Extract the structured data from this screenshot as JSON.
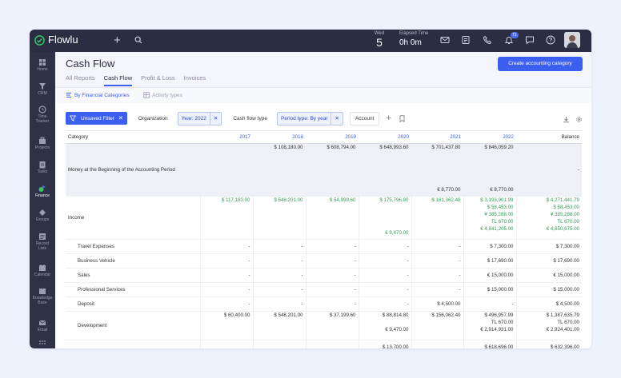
{
  "app": {
    "name": "Flowlu"
  },
  "topbar": {
    "date_weekday": "Wed",
    "date_day": "5",
    "elapsed_label": "Elapsed Time",
    "elapsed_value": "0h 0m",
    "notification_count": "71"
  },
  "sidebar": {
    "items": [
      {
        "label": "Home",
        "icon": "home-icon"
      },
      {
        "label": "CRM",
        "icon": "crm-icon"
      },
      {
        "label": "Time Tracker",
        "icon": "clock-icon"
      },
      {
        "label": "Projects",
        "icon": "projects-icon"
      },
      {
        "label": "Tasks",
        "icon": "tasks-icon"
      },
      {
        "label": "Finance",
        "icon": "finance-icon"
      },
      {
        "label": "Groups",
        "icon": "groups-icon"
      },
      {
        "label": "Record Lists",
        "icon": "record-lists-icon"
      },
      {
        "label": "Calendar",
        "icon": "calendar-icon"
      },
      {
        "label": "Knowledge Base",
        "icon": "knowledge-base-icon"
      },
      {
        "label": "Email",
        "icon": "email-icon"
      }
    ]
  },
  "header": {
    "title": "Cash Flow",
    "tabs": [
      "All Reports",
      "Cash Flow",
      "Profit & Loss",
      "Invoices"
    ],
    "create_button": "Create accounting category"
  },
  "subtabs": [
    "By Financial Categories",
    "Activity types"
  ],
  "filters": {
    "unsaved": "Unsaved Filter",
    "organization": "Organization",
    "year": "Year: 2022",
    "flow_type": "Cash flow type",
    "period": "Period type: By year",
    "account": "Account"
  },
  "table": {
    "headers": [
      "Category",
      "2017",
      "2018",
      "2019",
      "2020",
      "2021",
      "2022",
      "Balance"
    ],
    "money": {
      "label": "Money at the Beginning of the Accounting Period",
      "top": [
        "",
        "$ 108,180.00",
        "$ 608,794.00",
        "$ 648,993.60",
        "$ 701,437.80",
        "$ 846,059.20",
        ""
      ],
      "bottom": [
        "",
        "",
        "",
        "",
        "€ 8,770.00",
        "€ 8,770.00",
        ""
      ],
      "balance": "-"
    },
    "income": {
      "label": "Income",
      "top": [
        "$ 117,180.00",
        "$ 548,201.00",
        "$ 54,999.60",
        "$ 175,796.80",
        "$ 181,362.40",
        ""
      ],
      "col_2022": [
        "$ 3,193,901.99",
        "$ 58,453.00",
        "¥ 385,288.00",
        "TL 670.00",
        "€ 4,841,205.00"
      ],
      "col_balance": [
        "$ 4,271,441.79",
        "$ 58,453.00",
        "¥ 385,288.00",
        "TL 670.00",
        "€ 4,850,675.00"
      ],
      "bottom_2020": "€ 9,470.00"
    },
    "rows": [
      {
        "label": "Travel Expenses",
        "values": [
          "-",
          "-",
          "-",
          "-",
          "-",
          "$ 7,300.00",
          "$ 7,300.00"
        ]
      },
      {
        "label": "Business Vehicle",
        "values": [
          "-",
          "-",
          "-",
          "-",
          "-",
          "$ 17,690.00",
          "$ 17,690.00"
        ]
      },
      {
        "label": "Sales",
        "values": [
          "-",
          "-",
          "-",
          "-",
          "-",
          "€ 15,000.00",
          "€ 15,000.00"
        ]
      },
      {
        "label": "Professional Services",
        "values": [
          "-",
          "-",
          "-",
          "-",
          "-",
          "$ 15,000.00",
          "$ 15,000.00"
        ]
      },
      {
        "label": "Deposit",
        "values": [
          "-",
          "-",
          "-",
          "-",
          "$ 4,500.00",
          "-",
          "$ 4,500.00"
        ]
      }
    ],
    "development": {
      "label": "Development",
      "cells": [
        [
          "$ 60,400.00"
        ],
        [
          "$ 548,201.00"
        ],
        [
          "$ 37,199.60"
        ],
        [
          "$ 88,814.80",
          "",
          "€ 9,470.00"
        ],
        [
          "$ 156,062.40"
        ],
        [
          "$ 496,957.99",
          "TL 670.00",
          "€ 2,914,931.00"
        ],
        [
          "$ 1,387,635.79",
          "TL 670.00",
          "€ 2,924,401.00"
        ]
      ]
    },
    "partial": [
      "",
      "",
      "",
      "$ 13,700.00",
      "",
      "$ 618,696.00",
      "$ 632,396.00"
    ]
  }
}
